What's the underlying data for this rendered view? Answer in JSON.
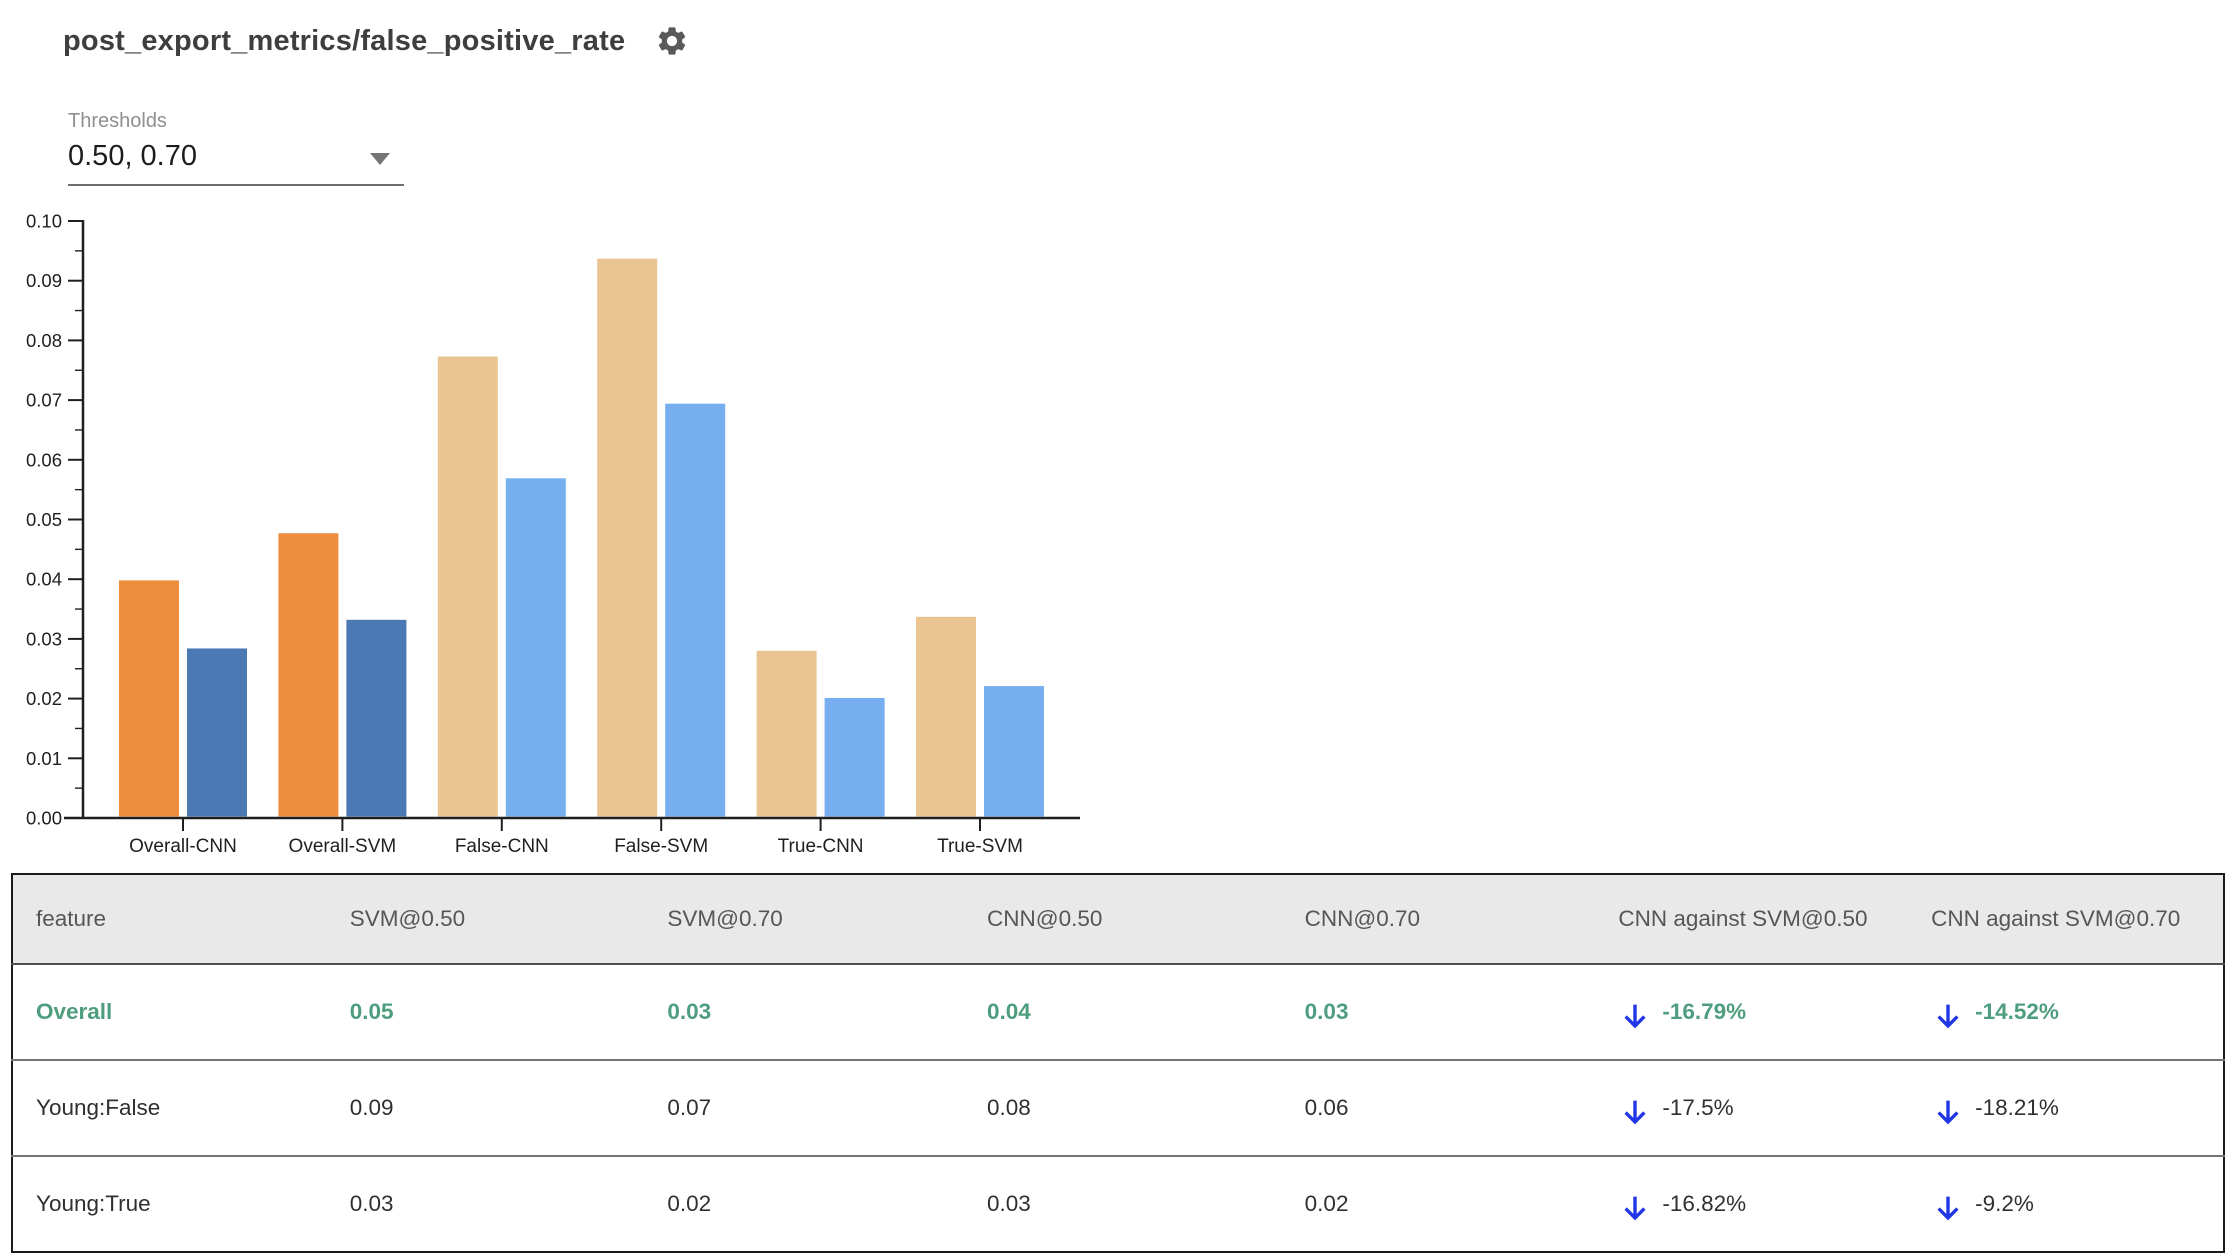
{
  "header": {
    "title": "post_export_metrics/false_positive_rate"
  },
  "controls": {
    "thresholds_label": "Thresholds",
    "thresholds_value": "0.50, 0.70"
  },
  "icons": {
    "gear": "settings-gear",
    "dropdown_arrow": "triangle-down",
    "delta_arrow": "arrow-downward"
  },
  "colors": {
    "overall_threshold_050": "#ee8e3d",
    "overall_threshold_070": "#4b79b4",
    "slice_threshold_050": "#eac491",
    "slice_threshold_070": "#76aeef",
    "delta_arrow_blue": "#2136e4",
    "highlight_green": "#4d9d7e",
    "header_bg": "#e9e9e9"
  },
  "chart_data": {
    "type": "bar",
    "title": "",
    "xlabel": "",
    "ylabel": "",
    "categories": [
      "Overall-CNN",
      "Overall-SVM",
      "False-CNN",
      "False-SVM",
      "True-CNN",
      "True-SVM"
    ],
    "series": [
      {
        "name": "threshold 0.50",
        "values": [
          0.0398,
          0.0477,
          0.0773,
          0.0937,
          0.028,
          0.0337
        ]
      },
      {
        "name": "threshold 0.70",
        "values": [
          0.0284,
          0.0332,
          0.0569,
          0.0694,
          0.0201,
          0.0221
        ]
      }
    ],
    "overall_group_indices": [
      0,
      1
    ],
    "ylim": [
      0,
      0.1
    ],
    "ytick_step": 0.01,
    "grid": false,
    "legend_position": "none"
  },
  "table": {
    "columns": [
      "feature",
      "SVM@0.50",
      "SVM@0.70",
      "CNN@0.50",
      "CNN@0.70",
      "CNN against SVM@0.50",
      "CNN against SVM@0.70"
    ],
    "rows": [
      {
        "feature": "Overall",
        "svm_050": "0.05",
        "svm_070": "0.03",
        "cnn_050": "0.04",
        "cnn_070": "0.03",
        "delta_050": "-16.79%",
        "delta_070": "-14.52%"
      },
      {
        "feature": "Young:False",
        "svm_050": "0.09",
        "svm_070": "0.07",
        "cnn_050": "0.08",
        "cnn_070": "0.06",
        "delta_050": "-17.5%",
        "delta_070": "-18.21%"
      },
      {
        "feature": "Young:True",
        "svm_050": "0.03",
        "svm_070": "0.02",
        "cnn_050": "0.03",
        "cnn_070": "0.02",
        "delta_050": "-16.82%",
        "delta_070": "-9.2%"
      }
    ]
  }
}
